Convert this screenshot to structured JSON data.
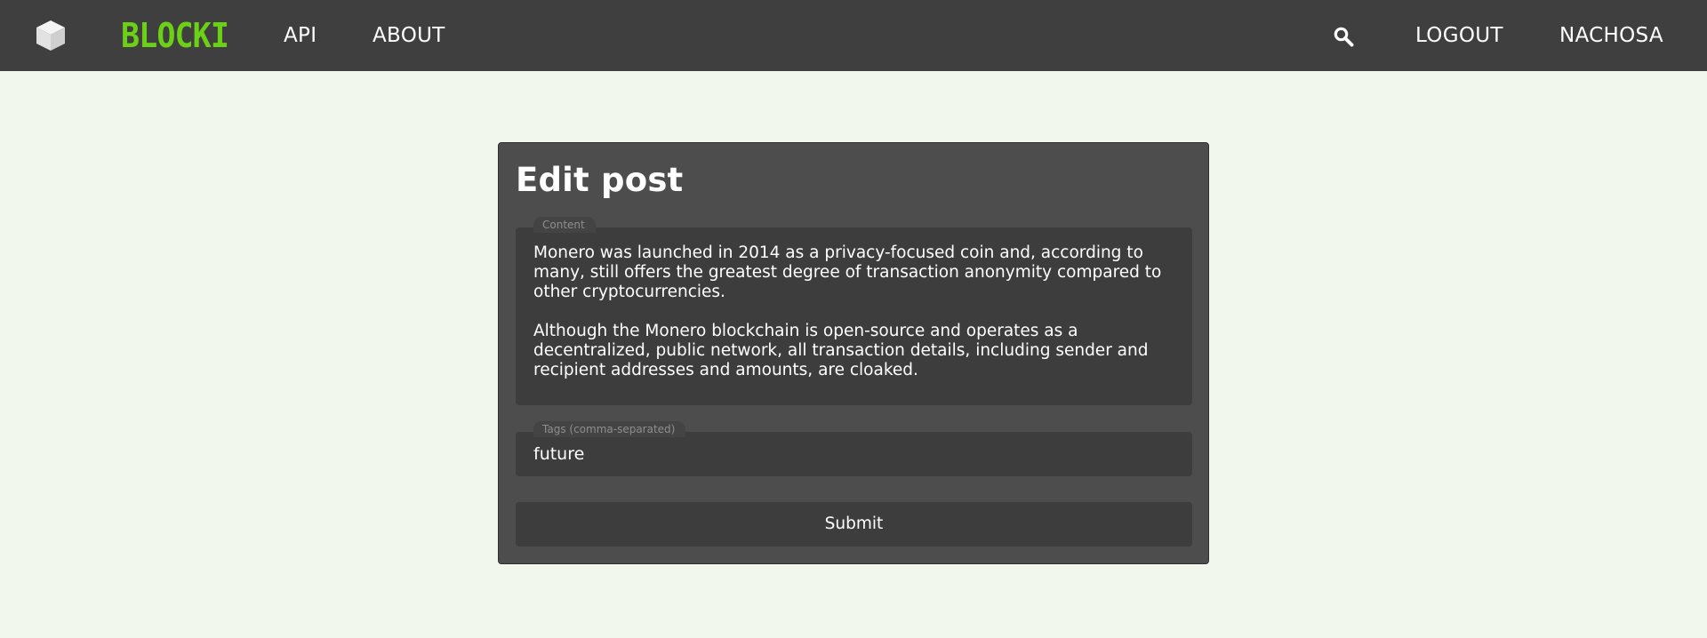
{
  "colors": {
    "navbar_bg": "#3f3f3f",
    "page_bg": "#f1f7ed",
    "brand_green": "#6cd116",
    "card_bg": "#4d4d4d",
    "field_bg": "#3d3d3d"
  },
  "navbar": {
    "logo_icon": "cube-icon",
    "brand": "BLOCKI",
    "links": {
      "api": "API",
      "about": "ABOUT"
    },
    "search_icon": "search-icon",
    "logout": "LOGOUT",
    "username": "NACHOSA"
  },
  "edit_post": {
    "title": "Edit post",
    "content": {
      "label": "Content",
      "paragraphs": [
        "Monero was launched in 2014 as a privacy-focused coin and, according to many, still offers the greatest degree of transaction anonymity compared to other cryptocurrencies.",
        "Although the Monero blockchain is open-source and operates as a decentralized, public network, all transaction details, including sender and recipient addresses and amounts, are cloaked."
      ]
    },
    "tags": {
      "label": "Tags (comma-separated)",
      "value": "future"
    },
    "submit_label": "Submit"
  }
}
